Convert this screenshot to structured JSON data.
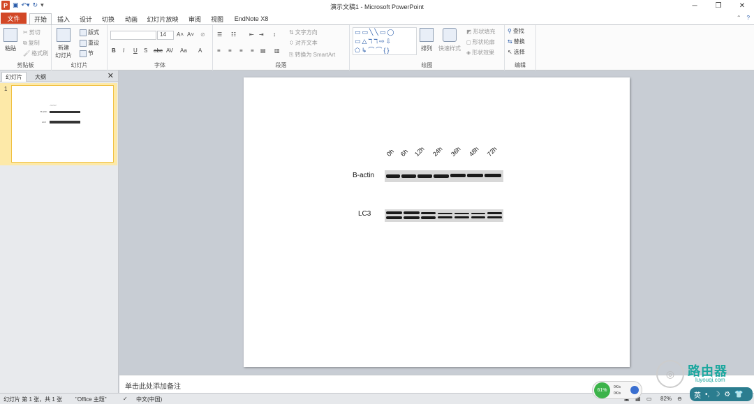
{
  "window": {
    "title": "演示文稿1 - Microsoft PowerPoint",
    "logo_letter": "P"
  },
  "tabs": {
    "file": "文件",
    "home": "开始",
    "insert": "插入",
    "design": "设计",
    "transitions": "切换",
    "animations": "动画",
    "slideshow": "幻灯片放映",
    "review": "审阅",
    "view": "视图",
    "endnote": "EndNote X8"
  },
  "ribbon": {
    "clipboard": {
      "label": "剪贴板",
      "paste": "粘贴",
      "cut": "剪切",
      "copy": "复制",
      "format_painter": "格式刷"
    },
    "slides": {
      "label": "幻灯片",
      "new_slide_line1": "新建",
      "new_slide_line2": "幻灯片",
      "layout": "版式",
      "reset": "重设",
      "section": "节"
    },
    "font": {
      "label": "字体",
      "font_name": "",
      "font_size": "14"
    },
    "paragraph": {
      "label": "段落",
      "text_direction": "文字方向",
      "align_text": "对齐文本",
      "convert_smartart": "转换为 SmartArt"
    },
    "drawing": {
      "label": "绘图",
      "arrange": "排列",
      "quick_styles": "快速样式",
      "shape_fill": "形状填充",
      "shape_outline": "形状轮廓",
      "shape_effects": "形状效果",
      "shapes_row1": "▭▭╲╲▭◯",
      "shapes_row2": "▭△ℸℸ⇨⇩",
      "shapes_row3": "⬠↳⌒⌒{}"
    },
    "editing": {
      "label": "编辑",
      "find": "查找",
      "replace": "替换",
      "select": "选择"
    }
  },
  "left_panel": {
    "tab_slides": "幻灯片",
    "tab_outline": "大纲",
    "slide_number": "1"
  },
  "slide": {
    "lane_labels": [
      "0h",
      "6h",
      "12h",
      "24h",
      "36h",
      "48h",
      "72h"
    ],
    "row_labels": [
      "B-actin",
      "LC3"
    ]
  },
  "notes": {
    "placeholder": "单击此处添加备注"
  },
  "status": {
    "slide_info": "幻灯片 第 1 张，共 1 张",
    "theme": "\"Office 主题\"",
    "language": "中文(中国)",
    "zoom": "82%"
  },
  "overlay": {
    "net_percent": "61%",
    "up_speed": "0K/s",
    "down_speed": "0K/s",
    "ime_lang": "英",
    "watermark_text": "路由器",
    "watermark_url": "luyouqi.com"
  }
}
